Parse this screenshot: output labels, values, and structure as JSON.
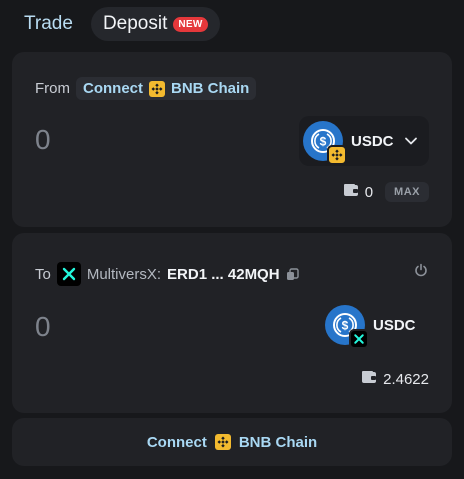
{
  "tabs": {
    "trade": "Trade",
    "deposit": "Deposit",
    "deposit_badge": "NEW"
  },
  "from": {
    "label": "From",
    "connect": "Connect",
    "chain": "BNB Chain",
    "amount": "0",
    "token": "USDC",
    "balance": "0",
    "max": "MAX"
  },
  "to": {
    "label": "To",
    "network": "MultiversX:",
    "address": "ERD1 ... 42MQH",
    "amount": "0",
    "token": "USDC",
    "balance": "2.4622"
  },
  "footer": {
    "connect": "Connect",
    "chain": "BNB Chain"
  },
  "colors": {
    "bnb": "#f3ba2f",
    "usdc": "#2775ca",
    "accent": "#a9d8f3",
    "new_badge": "#e5383b"
  },
  "icons": [
    "bnb-icon",
    "usdc-icon",
    "multiversx-icon",
    "wallet-icon",
    "copy-icon",
    "power-icon",
    "chevron-down-icon"
  ]
}
